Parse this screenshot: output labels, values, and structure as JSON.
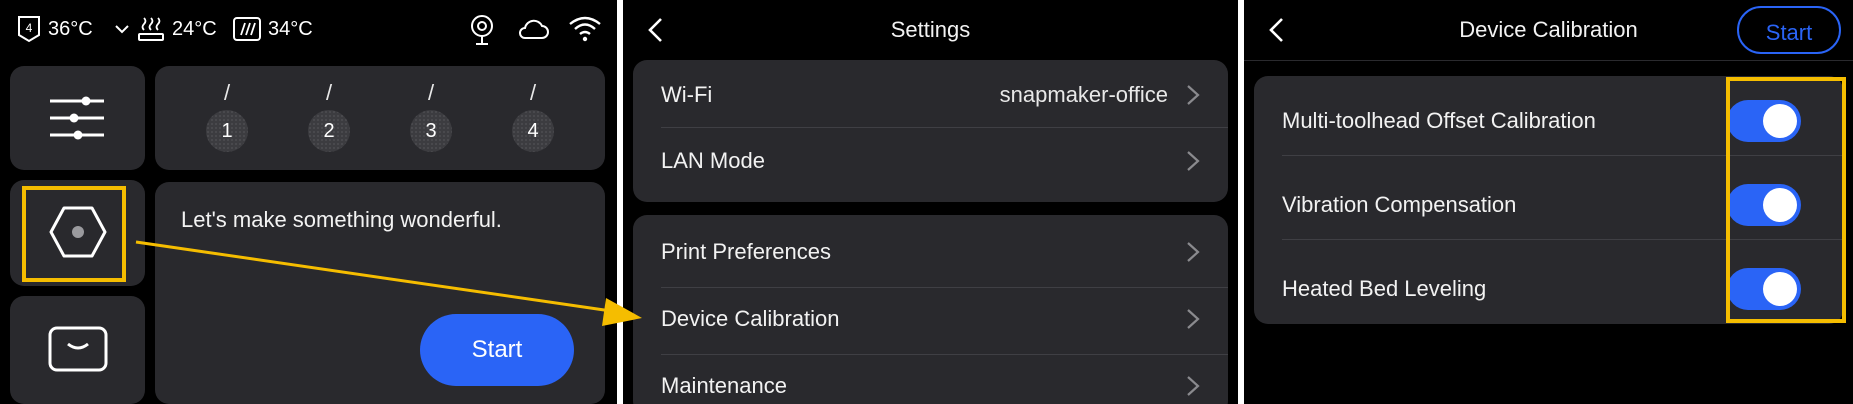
{
  "home": {
    "status": {
      "toolhead_num": "4",
      "toolhead_temp": "36°C",
      "bed_temp": "24°C",
      "chamber_temp": "34°C"
    },
    "slots": [
      {
        "num": "1",
        "filament": "/"
      },
      {
        "num": "2",
        "filament": "/"
      },
      {
        "num": "3",
        "filament": "/"
      },
      {
        "num": "4",
        "filament": "/"
      }
    ],
    "welcome": "Let's make something wonderful.",
    "start_label": "Start"
  },
  "settings": {
    "title": "Settings",
    "group1": [
      {
        "label": "Wi-Fi",
        "value": "snapmaker-office"
      },
      {
        "label": "LAN Mode",
        "value": ""
      }
    ],
    "group2": [
      {
        "label": "Print Preferences"
      },
      {
        "label": "Device Calibration"
      },
      {
        "label": "Maintenance"
      }
    ]
  },
  "calibration": {
    "title": "Device Calibration",
    "start_label": "Start",
    "items": [
      {
        "label": "Multi-toolhead Offset Calibration",
        "enabled": true
      },
      {
        "label": "Vibration Compensation",
        "enabled": true
      },
      {
        "label": "Heated Bed Leveling",
        "enabled": true
      }
    ]
  },
  "colors": {
    "accent": "#2a64f6",
    "highlight": "#f5bd00",
    "card": "#29292d",
    "background": "#000000"
  }
}
